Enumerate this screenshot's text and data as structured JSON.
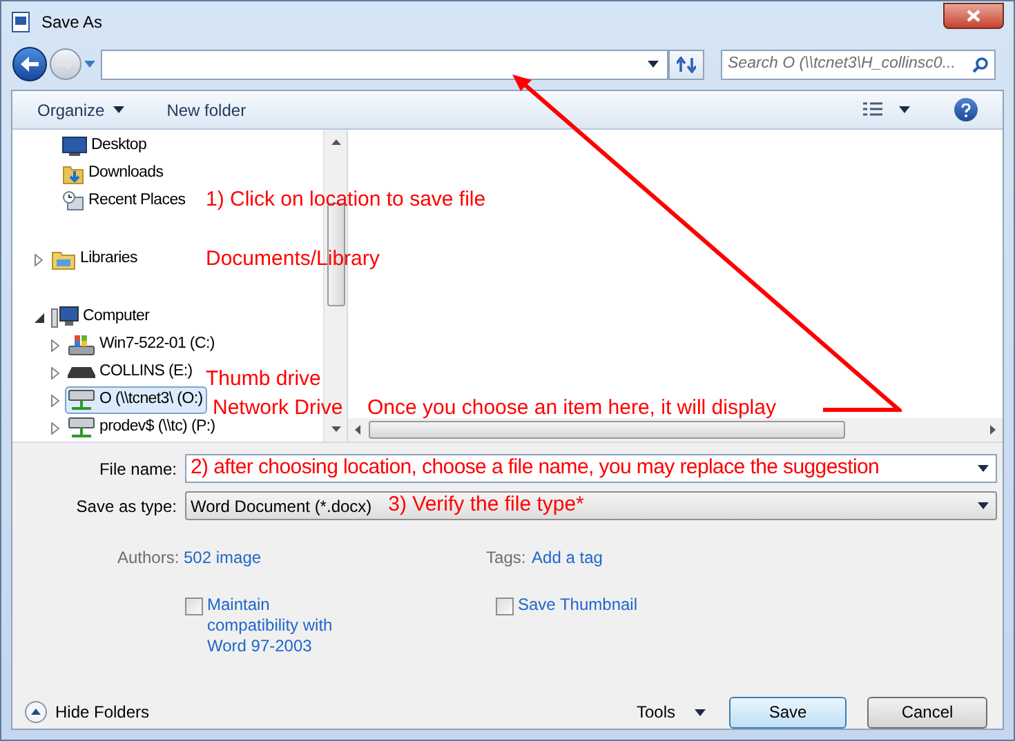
{
  "window": {
    "title": "Save As"
  },
  "address_bar": {
    "search_placeholder": "Search O (\\\\tcnet3\\H_collinsc0..."
  },
  "toolbar": {
    "organize": "Organize",
    "new_folder": "New folder"
  },
  "nav": [
    {
      "label": "Desktop",
      "kind": "desktop"
    },
    {
      "label": "Downloads",
      "kind": "downloads"
    },
    {
      "label": "Recent Places",
      "kind": "recent"
    },
    {
      "kind": "gap"
    },
    {
      "label": "Libraries",
      "kind": "library",
      "expanded": false,
      "selected": false
    },
    {
      "kind": "gap"
    },
    {
      "label": "Computer",
      "kind": "computer",
      "expanded": true,
      "selected": false,
      "children": [
        {
          "label": "Win7-522-01 (C:)",
          "kind": "osdrive",
          "expanded": false,
          "selected": false
        },
        {
          "label": "COLLINS (E:)",
          "kind": "usbdrive",
          "expanded": false,
          "selected": false
        },
        {
          "label": "O (\\\\tcnet3\\ (O:)",
          "kind": "netdrive",
          "expanded": false,
          "selected": true
        },
        {
          "label": "prodev$ (\\\\tc) (P:)",
          "kind": "netdrive",
          "expanded": false,
          "selected": false
        }
      ]
    }
  ],
  "file_name": {
    "label": "File name:",
    "value": "2) after choosing location, choose a file name, you may replace the suggestion"
  },
  "save_as_type": {
    "label": "Save as type:",
    "value": "Word Document (*.docx)",
    "annotation": "3) Verify the file type*"
  },
  "authors": {
    "label": "Authors:",
    "value": "502 image"
  },
  "tags": {
    "label": "Tags:",
    "value": "Add a tag"
  },
  "checkboxes": [
    {
      "label": "Maintain compatibility with Word 97-2003",
      "checked": false
    },
    {
      "label": "Save Thumbnail",
      "checked": false
    }
  ],
  "hide_folders": "Hide Folders",
  "tools": "Tools",
  "buttons": [
    "Save",
    "Cancel"
  ],
  "annotations": [
    "1) Click on location to save file",
    "Documents/Library",
    "Thumb drive",
    "Network Drive",
    "Once you choose an item here, it will display"
  ]
}
